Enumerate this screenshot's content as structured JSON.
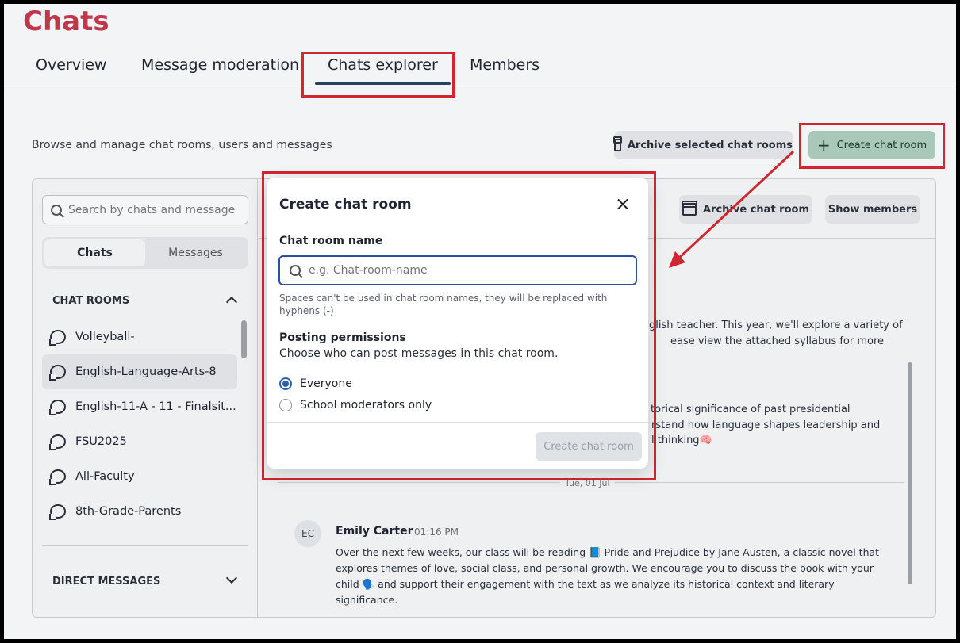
{
  "app": {
    "title": "Chats"
  },
  "tabs": [
    {
      "label": "Overview"
    },
    {
      "label": "Message moderation"
    },
    {
      "label": "Chats explorer"
    },
    {
      "label": "Members"
    }
  ],
  "page": {
    "subtitle": "Browse and manage chat rooms, users and messages",
    "archive_selected_label": "Archive selected chat rooms",
    "create_label": "Create chat room"
  },
  "sidebar": {
    "search_placeholder": "Search by chats and messages",
    "segments": [
      "Chats",
      "Messages"
    ],
    "chat_rooms_heading": "CHAT ROOMS",
    "rooms": [
      {
        "label": "Volleyball-"
      },
      {
        "label": "English-Language-Arts-8"
      },
      {
        "label": "English-11-A - 11 - Finalsit..."
      },
      {
        "label": "FSU2025"
      },
      {
        "label": "All-Faculty"
      },
      {
        "label": "8th-Grade-Parents"
      }
    ],
    "direct_messages_heading": "DIRECT MESSAGES"
  },
  "detail": {
    "archive_room_label": "Archive chat room",
    "show_members_label": "Show members",
    "partial_lines": [
      "glish teacher. This year, we'll explore a variety of",
      "ease view the attached syllabus for more",
      "torical significance of past presidential",
      "rstand how language shapes leadership and",
      "l thinking🧠"
    ],
    "date_separator": "Tue, 01 Jul",
    "message": {
      "initials": "EC",
      "author": "Emily Carter",
      "time": "01:16 PM",
      "body": "Over the next few weeks, our class will be reading 📘 Pride and Prejudice by Jane Austen, a classic novel that explores themes of love, social class, and personal growth. We encourage you to discuss the book with your child 🗣️ and support their engagement with the text as we analyze its historical context and literary significance."
    }
  },
  "modal": {
    "title": "Create chat room",
    "name_label": "Chat room name",
    "name_placeholder": "e.g. Chat-room-name",
    "name_hint": "Spaces can't be used in chat room names, they will be replaced with hyphens (-)",
    "permissions_label": "Posting permissions",
    "permissions_desc": "Choose who can post messages in this chat room.",
    "options": [
      {
        "label": "Everyone",
        "selected": true
      },
      {
        "label": "School moderators only",
        "selected": false
      }
    ],
    "submit_label": "Create chat room"
  },
  "colors": {
    "brand": "#c0364a",
    "annotation": "#d0262f",
    "accent": "#2e63a8"
  }
}
